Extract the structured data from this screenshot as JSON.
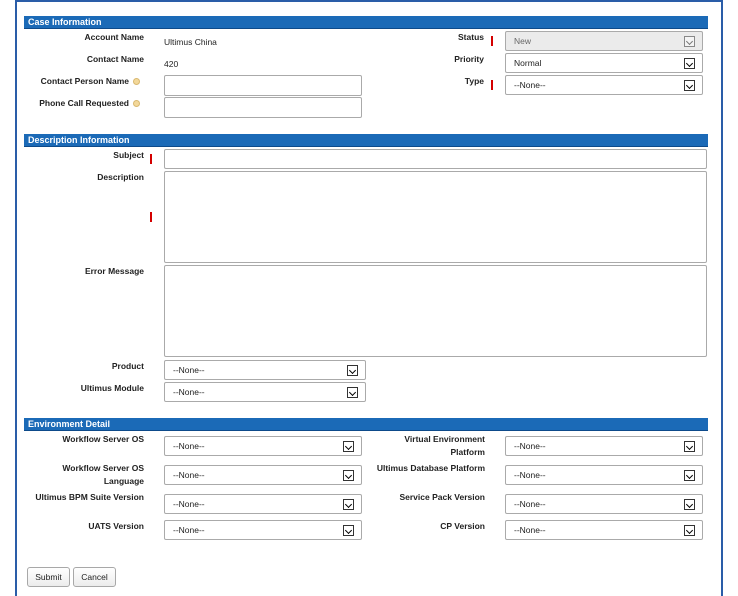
{
  "case_info": {
    "title": "Case Information",
    "account_name_label": "Account Name",
    "account_name_value": "Ultimus China",
    "contact_name_label": "Contact Name",
    "contact_name_value": "420",
    "contact_person_label": "Contact Person Name",
    "phone_call_label": "Phone Call Requested",
    "status_label": "Status",
    "status_value": "New",
    "priority_label": "Priority",
    "priority_value": "Normal",
    "type_label": "Type",
    "type_value": "--None--"
  },
  "description_info": {
    "title": "Description Information",
    "subject_label": "Subject",
    "description_label": "Description",
    "error_message_label": "Error Message",
    "product_label": "Product",
    "product_value": "--None--",
    "module_label": "Ultimus Module",
    "module_value": "--None--"
  },
  "environment": {
    "title": "Environment Detail",
    "wf_os_label": "Workflow Server OS",
    "wf_os_value": "--None--",
    "virtual_label_1": "Virtual Environment",
    "virtual_label_2": "Platform",
    "virtual_value": "--None--",
    "wf_lang_label_1": "Workflow Server OS",
    "wf_lang_label_2": "Language",
    "wf_lang_value": "--None--",
    "db_platform_label": "Ultimus Database Platform",
    "db_platform_value": "--None--",
    "bpm_version_label": "Ultimus BPM Suite Version",
    "bpm_version_value": "--None--",
    "service_pack_label": "Service Pack Version",
    "service_pack_value": "--None--",
    "uats_label": "UATS Version",
    "uats_value": "--None--",
    "cp_label": "CP Version",
    "cp_value": "--None--"
  },
  "actions": {
    "submit_label": "Submit",
    "cancel_label": "Cancel"
  }
}
